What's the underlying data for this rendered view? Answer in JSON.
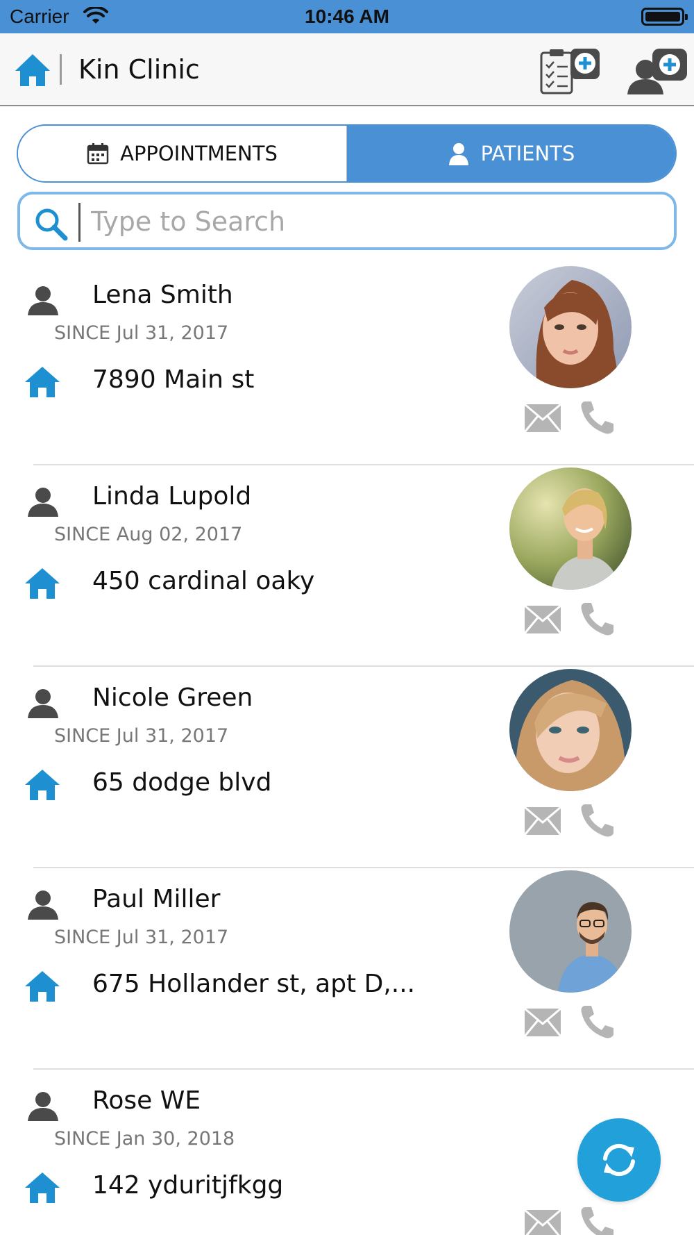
{
  "status_bar": {
    "carrier": "Carrier",
    "time": "10:46 AM"
  },
  "nav": {
    "title": "Kin Clinic",
    "icons": [
      "home-icon",
      "add-appointment-icon",
      "add-patient-icon"
    ]
  },
  "tabs": [
    {
      "label": "APPOINTMENTS",
      "icon": "calendar-icon",
      "active": false
    },
    {
      "label": "PATIENTS",
      "icon": "person-icon",
      "active": true
    }
  ],
  "search": {
    "placeholder": "Type to Search",
    "value": ""
  },
  "patients": [
    {
      "name": "Lena Smith",
      "since": "SINCE Jul 31, 2017",
      "address": "7890 Main st",
      "has_photo": true
    },
    {
      "name": "Linda Lupold",
      "since": "SINCE Aug 02, 2017",
      "address": "450 cardinal oaky",
      "has_photo": true
    },
    {
      "name": "Nicole Green",
      "since": "SINCE Jul 31, 2017",
      "address": "65 dodge blvd",
      "has_photo": true
    },
    {
      "name": "Paul Miller",
      "since": "SINCE Jul 31, 2017",
      "address": "675 Hollander st, apt D,...",
      "has_photo": true
    },
    {
      "name": "Rose WE",
      "since": "SINCE Jan 30, 2018",
      "address": "142 yduritjfkgg",
      "has_photo": false
    }
  ],
  "fab": {
    "icon": "refresh-icon"
  },
  "colors": {
    "accent": "#4a90d4",
    "icon_blue": "#1e8fd0",
    "fab": "#21a0da",
    "muted_icon": "#b5b5b5"
  }
}
